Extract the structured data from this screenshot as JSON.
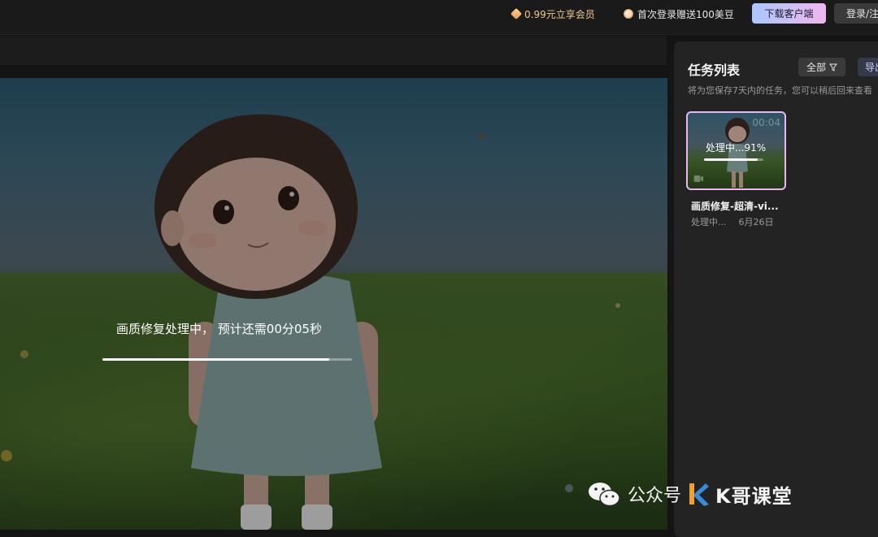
{
  "topbar": {
    "vip_promo": "0.99元立享会员",
    "bean_promo": "首次登录赠送100美豆",
    "download_label": "下载客户端",
    "login_label": "登录/注册"
  },
  "preview": {
    "progress_text": "画质修复处理中， 预计还需00分05秒",
    "progress": 0.91
  },
  "task_panel": {
    "title": "任务列表",
    "filter_label": "全部",
    "nav_label": "导出",
    "description": "将为您保存7天内的任务，您可以稍后回来查看",
    "tasks": [
      {
        "duration": "00:04",
        "status_overlay": "处理中...91%",
        "progress": 0.91,
        "name": "画质修复-超清-vi...",
        "status": "处理中...",
        "date": "6月26日"
      }
    ]
  },
  "watermark": {
    "label": "公众号",
    "brand": "K哥课堂"
  },
  "colors": {
    "accent_gradient_start": "#a9c7ff",
    "accent_gradient_end": "#f0b7ee",
    "vip_gold": "#f0c98a",
    "selected_border": "#eab6f0"
  }
}
